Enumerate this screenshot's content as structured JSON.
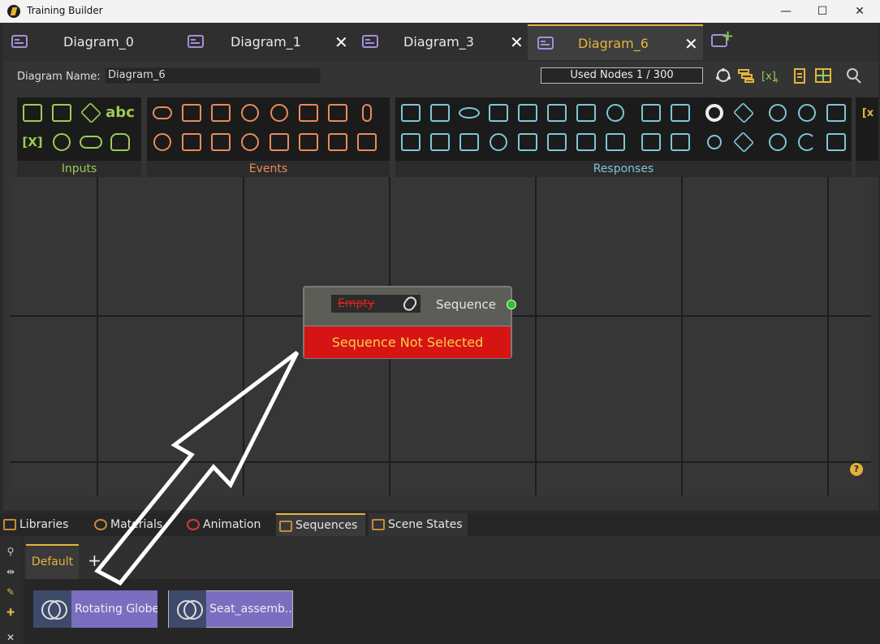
{
  "window": {
    "title": "Training Builder",
    "minimize_glyph": "—",
    "maximize_glyph": "☐",
    "close_glyph": "✕"
  },
  "tabs": [
    {
      "label": "Diagram_0",
      "active": false
    },
    {
      "label": "Diagram_1",
      "active": false
    },
    {
      "label": "Diagram_3",
      "active": false
    },
    {
      "label": "Diagram_6",
      "active": true
    }
  ],
  "tab_close_glyph": "✕",
  "toolbar": {
    "diagram_name_label": "Diagram Name:",
    "diagram_name_value": "Diagram_6",
    "used_nodes": "Used Nodes 1 / 300"
  },
  "palette": {
    "groups": [
      {
        "label": "Inputs",
        "color": "#9ccc52"
      },
      {
        "label": "Events",
        "color": "#e98b5a"
      },
      {
        "label": "Responses",
        "color": "#7ec6d6"
      }
    ],
    "inputs_text_icon": "abc",
    "inputs_var_icon": "[X]"
  },
  "node": {
    "field_value": "Empty",
    "output_label": "Sequence",
    "error_message": "Sequence Not Selected"
  },
  "bottom_tabs": [
    {
      "label": "Libraries",
      "active": false
    },
    {
      "label": "Materials",
      "active": false
    },
    {
      "label": "Animation",
      "active": false
    },
    {
      "label": "Sequences",
      "active": true
    },
    {
      "label": "Scene States",
      "active": false
    }
  ],
  "sub_tabs": {
    "default_label": "Default",
    "add_glyph": "+"
  },
  "sequences": [
    {
      "label": "Rotating Globe"
    },
    {
      "label": "Seat_assemb..."
    }
  ],
  "help_glyph": "?"
}
